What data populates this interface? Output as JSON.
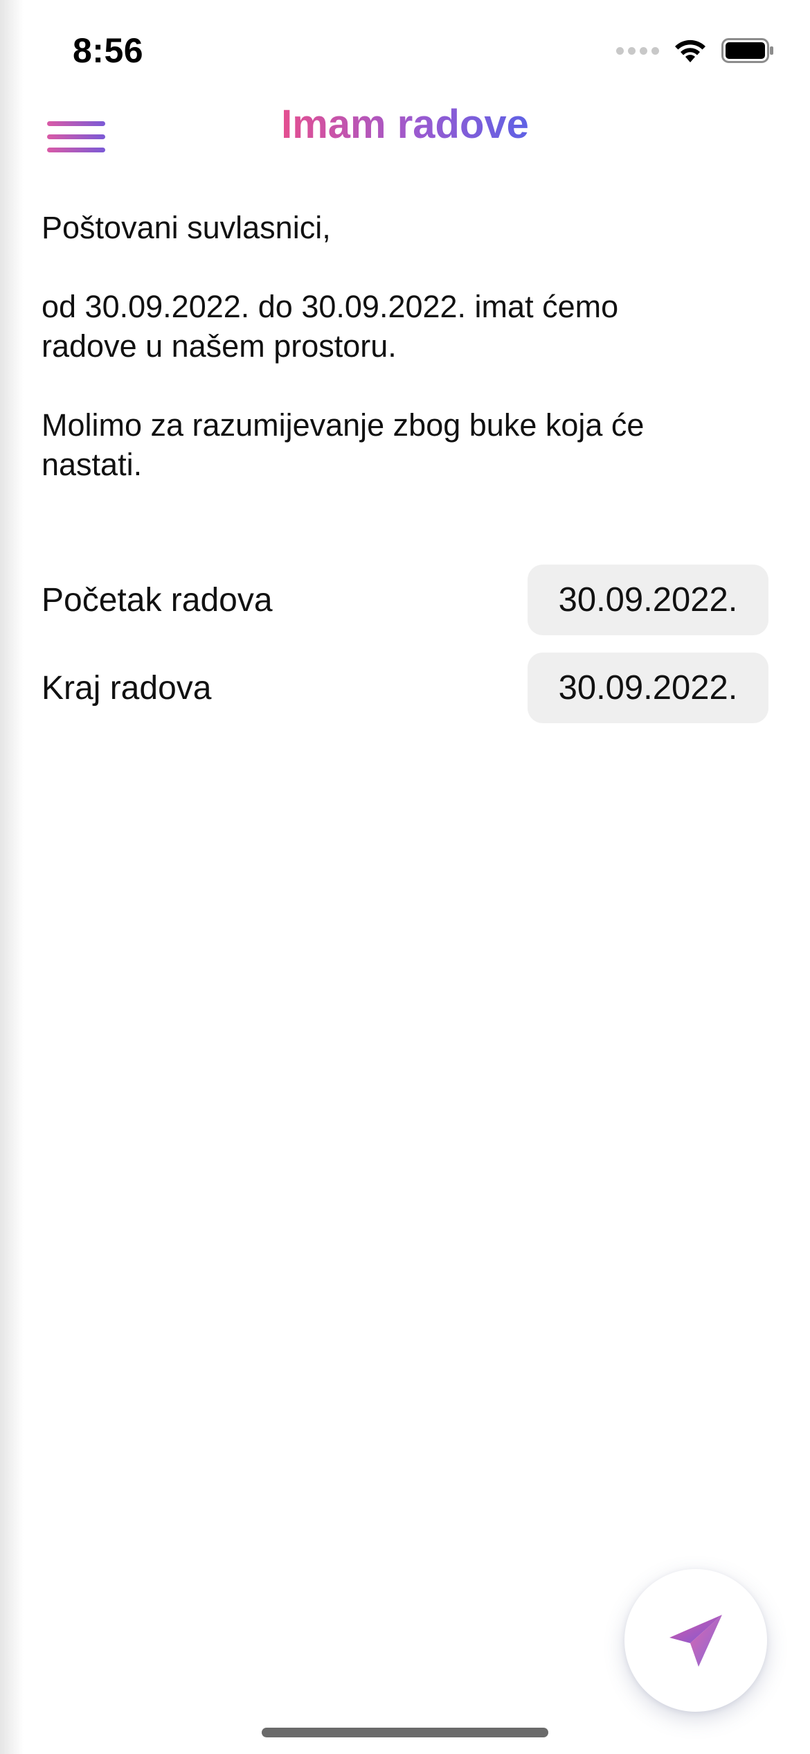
{
  "status_bar": {
    "time": "8:56"
  },
  "header": {
    "title": "Imam radove"
  },
  "message": {
    "greeting": "Poštovani suvlasnici,",
    "line1": "od 30.09.2022. do 30.09.2022. imat ćemo radove u našem prostoru.",
    "line2": "Molimo za razumijevanje zbog buke koja će nastati."
  },
  "fields": {
    "start": {
      "label": "Početak radova",
      "value": "30.09.2022."
    },
    "end": {
      "label": "Kraj radova",
      "value": "30.09.2022."
    }
  },
  "icons": {
    "menu": "hamburger-menu-icon",
    "send": "paper-plane-send-icon",
    "wifi": "wifi-icon",
    "battery": "battery-icon"
  },
  "colors": {
    "title_gradient_start": "#e94e8c",
    "title_gradient_end": "#5a62e6",
    "pill_background": "#efefef"
  }
}
